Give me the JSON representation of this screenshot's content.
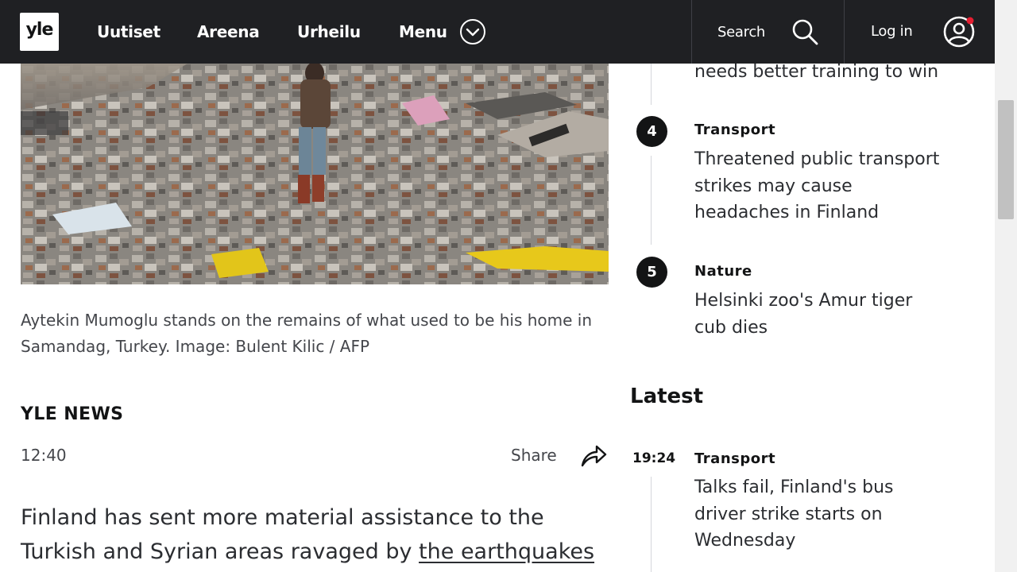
{
  "nav": {
    "logo": "yle",
    "items": [
      "Uutiset",
      "Areena",
      "Urheilu"
    ],
    "menu_label": "Menu",
    "search_label": "Search",
    "login_label": "Log in",
    "notification_color": "#e61e31"
  },
  "article": {
    "caption": "Aytekin Mumoglu stands on the remains of what used to be his home in Samandag, Turkey. Image: Bulent Kilic / AFP",
    "source": "YLE NEWS",
    "time": "12:40",
    "share_label": "Share",
    "lead_text": "Finland has sent more material assistance to the Turkish and Syrian areas ravaged by ",
    "lead_link": "the earthquakes"
  },
  "most_read": {
    "partial_headline": "needs better training to win",
    "items": [
      {
        "rank": "4",
        "category": "Transport",
        "headline": "Threatened public transport strikes may cause headaches in Finland"
      },
      {
        "rank": "5",
        "category": "Nature",
        "headline": "Helsinki zoo's Amur tiger cub dies"
      }
    ]
  },
  "latest": {
    "title": "Latest",
    "items": [
      {
        "time": "19:24",
        "category": "Transport",
        "headline": "Talks fail, Finland's bus driver strike starts on Wednesday"
      }
    ]
  }
}
